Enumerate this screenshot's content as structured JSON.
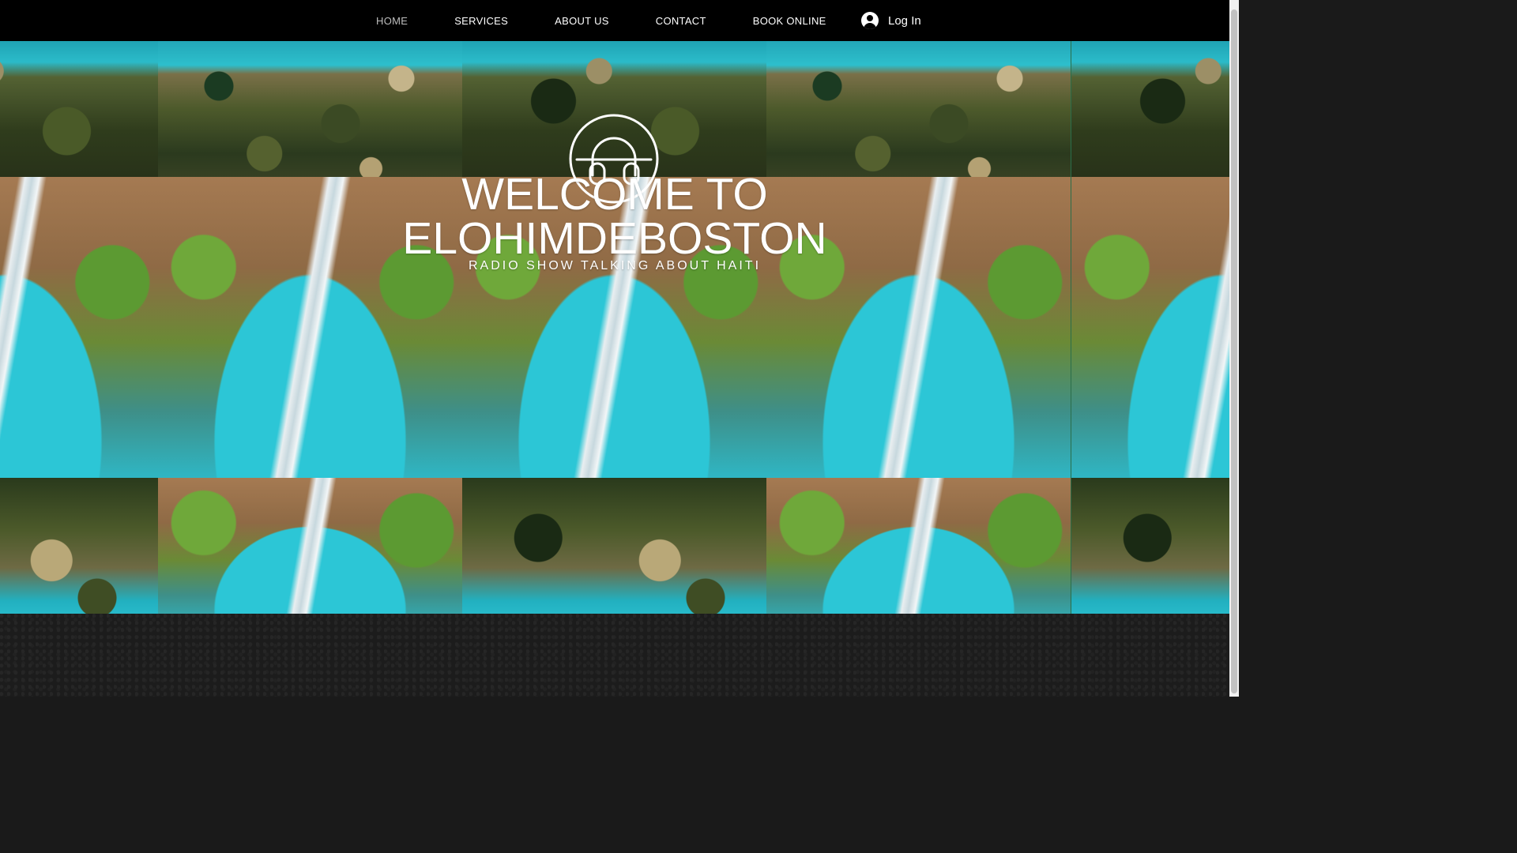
{
  "nav": {
    "items": [
      {
        "label": "HOME",
        "active": true
      },
      {
        "label": "SERVICES"
      },
      {
        "label": "ABOUT US"
      },
      {
        "label": "CONTACT"
      },
      {
        "label": "BOOK ONLINE"
      }
    ],
    "login_label": "Log In"
  },
  "hero": {
    "title_line1": "WELCOME TO",
    "title_line2": "ELOHIMDEBOSTON",
    "subtitle": "RADIO SHOW TALKING ABOUT HAITI",
    "logo_icon": "headphones-icon"
  },
  "colors": {
    "header_bg": "#000000",
    "nav_text": "#ffffff",
    "nav_active": "#bdbdbd",
    "footer_bg": "#1c1c1c"
  }
}
